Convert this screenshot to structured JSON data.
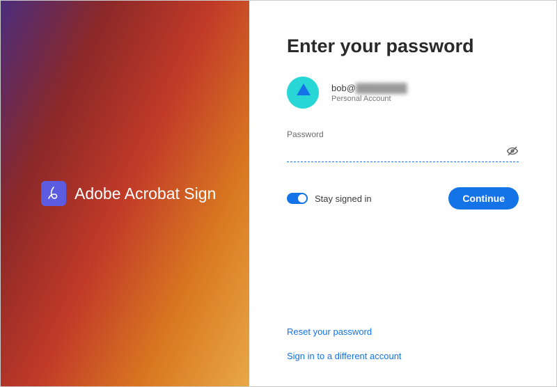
{
  "brand": {
    "product_name": "Adobe Acrobat Sign"
  },
  "main": {
    "title": "Enter your password",
    "account": {
      "email_prefix": "bob@",
      "email_blurred": "████████",
      "type": "Personal Account"
    },
    "password": {
      "label": "Password",
      "value": ""
    },
    "stay_signed_in": {
      "label": "Stay signed in",
      "on": true
    },
    "continue_label": "Continue"
  },
  "links": {
    "reset_password": "Reset your password",
    "different_account": "Sign in to a different account"
  },
  "colors": {
    "accent": "#1473e6",
    "brand_icon_bg": "#5c5ce0"
  }
}
